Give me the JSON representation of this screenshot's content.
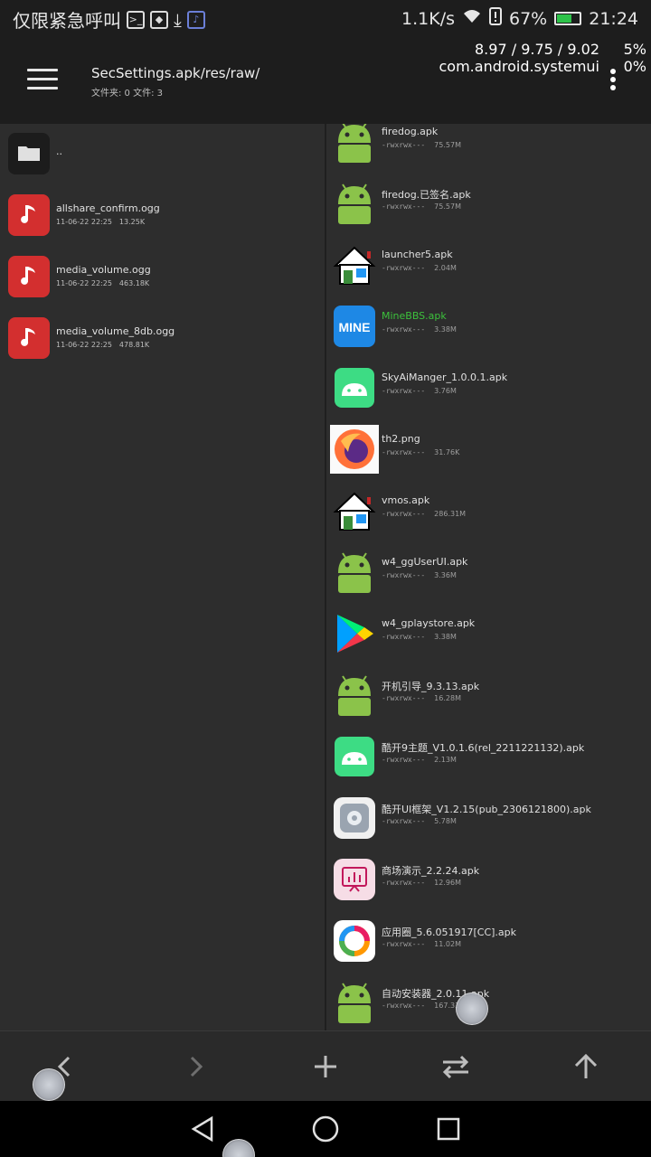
{
  "status_bar": {
    "left_text": "仅限紧急呼叫",
    "net_speed": "1.1K/s",
    "battery_percent": "67%",
    "battery_level": 0.67,
    "time": "21:24"
  },
  "header": {
    "path": "SecSettings.apk/res/raw/",
    "counts": "文件夹: 0  文件: 3",
    "stats_line1": "8.97 / 9.75 / 9.02",
    "stats_line2": "com.android.systemui",
    "pct_line1": "5%",
    "pct_line2": "0%"
  },
  "left_pane": {
    "items": [
      {
        "name": "..",
        "date": "",
        "size": "",
        "icon": "folder-icon"
      },
      {
        "name": "allshare_confirm.ogg",
        "date": "11-06-22 22:25",
        "size": "13.25K",
        "icon": "music-icon"
      },
      {
        "name": "media_volume.ogg",
        "date": "11-06-22 22:25",
        "size": "463.18K",
        "icon": "music-icon"
      },
      {
        "name": "media_volume_8db.ogg",
        "date": "11-06-22 22:25",
        "size": "478.81K",
        "icon": "music-icon"
      }
    ]
  },
  "right_pane": {
    "items": [
      {
        "name": "firedog.apk",
        "perm": "-rwxrwx---",
        "size": "75.57M",
        "icon": "android-icon"
      },
      {
        "name": "firedog.已签名.apk",
        "perm": "-rwxrwx---",
        "size": "75.57M",
        "icon": "android-icon"
      },
      {
        "name": "launcher5.apk",
        "perm": "-rwxrwx---",
        "size": "2.04M",
        "icon": "house-icon"
      },
      {
        "name": "MineBBS.apk",
        "perm": "-rwxrwx---",
        "size": "3.38M",
        "icon": "minebbs-icon"
      },
      {
        "name": "SkyAiManger_1.0.0.1.apk",
        "perm": "-rwxrwx---",
        "size": "3.76M",
        "icon": "android-green-tile-icon"
      },
      {
        "name": "th2.png",
        "perm": "-rwxrwx---",
        "size": "31.76K",
        "icon": "firefox-image-icon"
      },
      {
        "name": "vmos.apk",
        "perm": "-rwxrwx---",
        "size": "286.31M",
        "icon": "house-icon"
      },
      {
        "name": "w4_ggUserUI.apk",
        "perm": "-rwxrwx---",
        "size": "3.36M",
        "icon": "android-icon"
      },
      {
        "name": "w4_gplaystore.apk",
        "perm": "-rwxrwx---",
        "size": "3.38M",
        "icon": "play-store-icon"
      },
      {
        "name": "开机引导_9.3.13.apk",
        "perm": "-rwxrwx---",
        "size": "16.28M",
        "icon": "android-icon"
      },
      {
        "name": "酷开9主题_V1.0.1.6(rel_2211221132).apk",
        "perm": "-rwxrwx---",
        "size": "2.13M",
        "icon": "android-green-tile-icon"
      },
      {
        "name": "酷开UI框架_V1.2.15(pub_2306121800).apk",
        "perm": "-rwxrwx---",
        "size": "5.78M",
        "icon": "gear-app-icon"
      },
      {
        "name": "商场演示_2.2.24.apk",
        "perm": "-rwxrwx---",
        "size": "12.96M",
        "icon": "presentation-icon"
      },
      {
        "name": "应用圈_5.6.051917[CC].apk",
        "perm": "-rwxrwx---",
        "size": "11.02M",
        "icon": "ring-icon"
      },
      {
        "name": "自动安装器_2.0.11.apk",
        "perm": "-rwxrwx---",
        "size": "167.33K",
        "icon": "android-icon"
      }
    ]
  },
  "minebbs_icon_text": "MINE",
  "colors": {
    "android_green": "#8bc34a",
    "music_red": "#d32f2f",
    "highlight_green": "#3cc13c"
  }
}
